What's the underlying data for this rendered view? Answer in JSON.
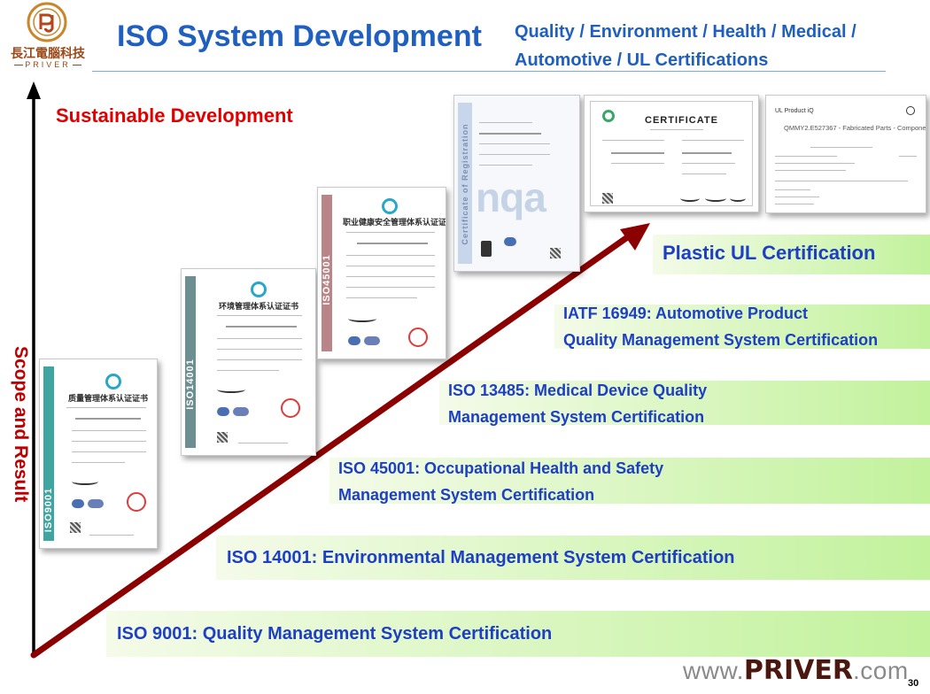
{
  "logo": {
    "text_cn": "長江電腦科技",
    "text_en": "PRIVER"
  },
  "header": {
    "title": "ISO System Development",
    "subtitle": "Quality / Environment / Health / Medical / Automotive / UL Certifications"
  },
  "axis": {
    "top_label": "Sustainable Development",
    "side_label": "Scope and Result"
  },
  "steps": [
    {
      "text": "ISO 9001: Quality Management System Certification"
    },
    {
      "text": "ISO 14001: Environmental Management System Certification"
    },
    {
      "line1": "ISO 45001: Occupational Health and Safety",
      "line2": "Management System Certification"
    },
    {
      "line1": "ISO 13485: Medical Device Quality",
      "line2": "Management System Certification"
    },
    {
      "line1": "IATF 16949: Automotive Product",
      "line2": "Quality Management System Certification"
    },
    {
      "text": "Plastic UL Certification"
    }
  ],
  "certificates": [
    {
      "vertical_label": "ISO9001"
    },
    {
      "vertical_label": "ISO14001"
    },
    {
      "vertical_label": "ISO45001"
    },
    {
      "vertical_label": "Certificate of Registration",
      "watermark": "nqa"
    },
    {
      "caption": "CERTIFICATE"
    },
    {
      "header_left": "UL Product iQ",
      "code": "QMMY2.E527367 - Fabricated Parts - Component"
    }
  ],
  "footer": {
    "www": "www.",
    "brand": "PRIVER",
    "domain": ".com",
    "page_number": "30"
  },
  "colors": {
    "title_blue": "#1f5fbf",
    "step_text_blue": "#1d3fc4",
    "band_green": "#c2f29c",
    "red_label": "#e00000",
    "arrow_red": "#8b0000"
  }
}
